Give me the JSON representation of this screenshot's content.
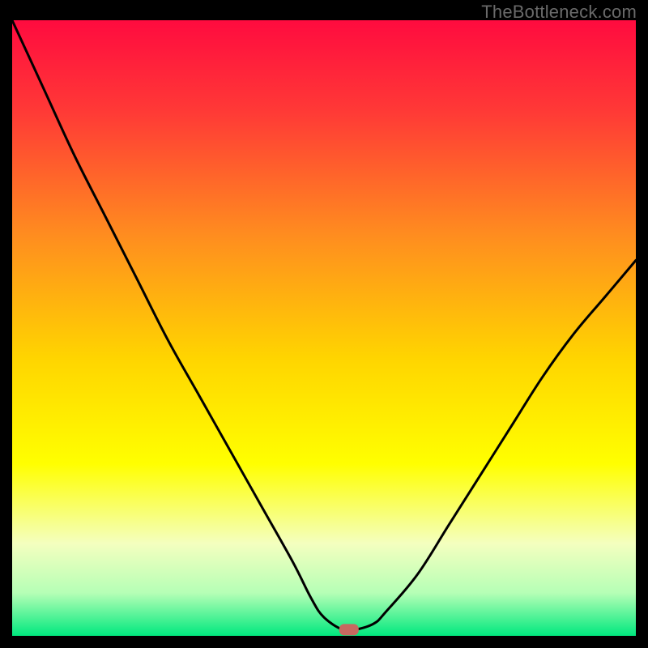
{
  "watermark": "TheBottleneck.com",
  "chart_data": {
    "type": "line",
    "title": "",
    "xlabel": "",
    "ylabel": "",
    "xlim": [
      0,
      100
    ],
    "ylim": [
      0,
      100
    ],
    "grid": false,
    "legend": false,
    "series": [
      {
        "name": "bottleneck-curve",
        "x": [
          0,
          5,
          10,
          15,
          20,
          25,
          30,
          35,
          40,
          45,
          48,
          50,
          53,
          55,
          58,
          60,
          65,
          70,
          75,
          80,
          85,
          90,
          95,
          100
        ],
        "y": [
          100,
          89,
          78,
          68,
          58,
          48,
          39,
          30,
          21,
          12,
          6,
          3,
          1,
          1,
          2,
          4,
          10,
          18,
          26,
          34,
          42,
          49,
          55,
          61
        ]
      }
    ],
    "marker": {
      "name": "optimal-point",
      "x": 54,
      "y": 1,
      "color": "#c76960"
    },
    "gradient_stops": [
      {
        "offset": 0.0,
        "color": "#ff0b3f"
      },
      {
        "offset": 0.15,
        "color": "#ff3a36"
      },
      {
        "offset": 0.35,
        "color": "#ff8d1f"
      },
      {
        "offset": 0.55,
        "color": "#ffd500"
      },
      {
        "offset": 0.72,
        "color": "#ffff00"
      },
      {
        "offset": 0.85,
        "color": "#f4ffbf"
      },
      {
        "offset": 0.93,
        "color": "#b6ffb6"
      },
      {
        "offset": 1.0,
        "color": "#00e87e"
      }
    ]
  }
}
